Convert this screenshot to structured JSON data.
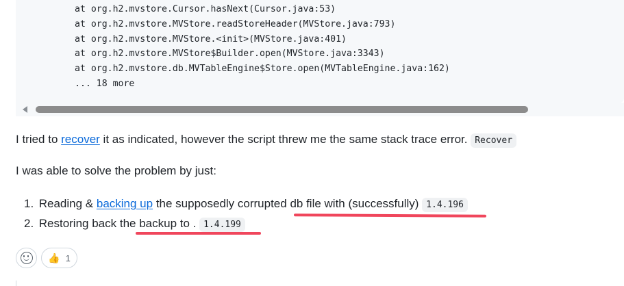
{
  "code": {
    "lines": [
      "at org.h2.mvstore.Cursor.hasNext(Cursor.java:53)",
      "at org.h2.mvstore.MVStore.readStoreHeader(MVStore.java:793)",
      "at org.h2.mvstore.MVStore.<init>(MVStore.java:401)",
      "at org.h2.mvstore.MVStore$Builder.open(MVStore.java:3343)",
      "at org.h2.mvstore.db.MVTableEngine$Store.open(MVTableEngine.java:162)",
      "... 18 more"
    ]
  },
  "paragraph1": {
    "before": "I tried to ",
    "link": "recover",
    "after": " it as indicated, however the script threw me the same stack trace error. ",
    "code": "Recover"
  },
  "paragraph2": "I was able to solve the problem by just:",
  "steps": [
    {
      "num": "1.",
      "before": "Reading & ",
      "link": "backing up",
      "after": " the supposedly corrupted db file with (successfully) ",
      "code": "1.4.196"
    },
    {
      "num": "2.",
      "before": "Restoring back the backup to . ",
      "code": "1.4.199"
    }
  ],
  "reactions": {
    "add_icon": "smiley-icon",
    "thumbs_up": {
      "emoji": "👍",
      "count": "1"
    }
  },
  "annotation_color": "#f0465c"
}
